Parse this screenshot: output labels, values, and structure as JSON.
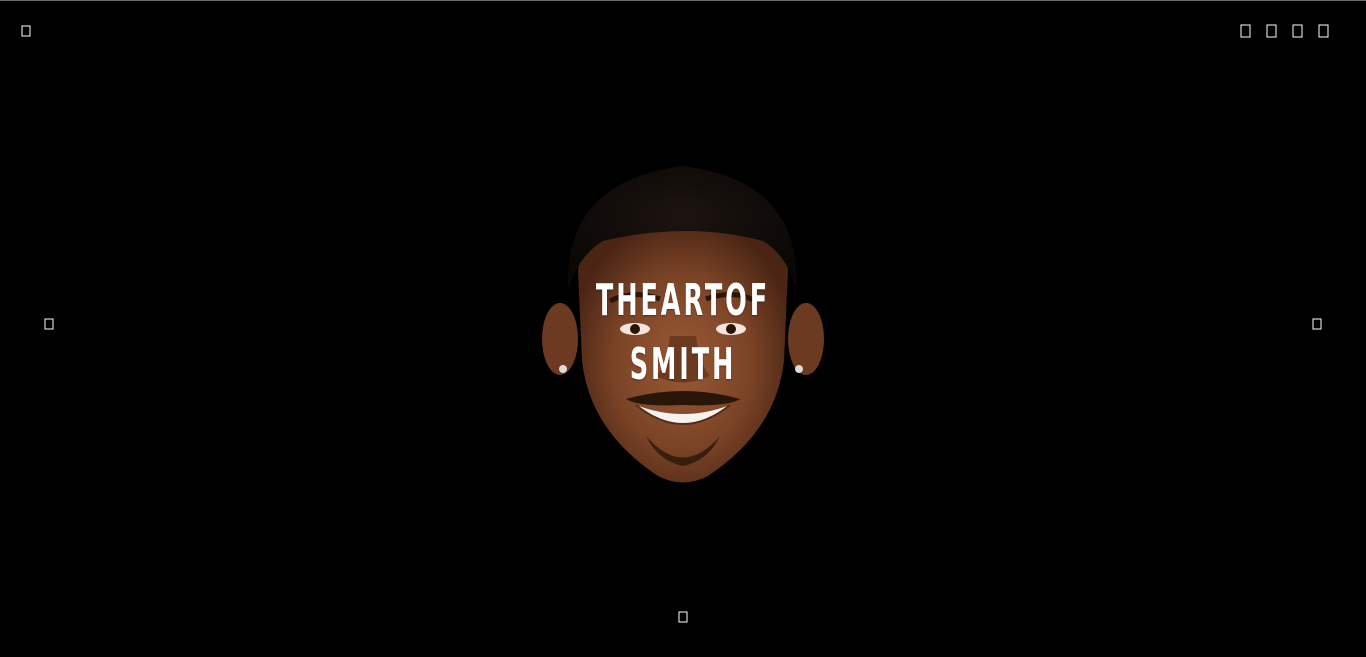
{
  "nav": {
    "menu_icon": "menu-icon",
    "prev_icon": "chevron-left-icon",
    "next_icon": "chevron-right-icon",
    "scroll_icon": "chevron-down-icon"
  },
  "social": [
    "social-icon-1",
    "social-icon-2",
    "social-icon-3",
    "social-icon-4"
  ],
  "hero": {
    "title_line1": "THEARTOF",
    "title_line2": "SMITH",
    "text_color": "#ffffff",
    "background": "#000000"
  }
}
